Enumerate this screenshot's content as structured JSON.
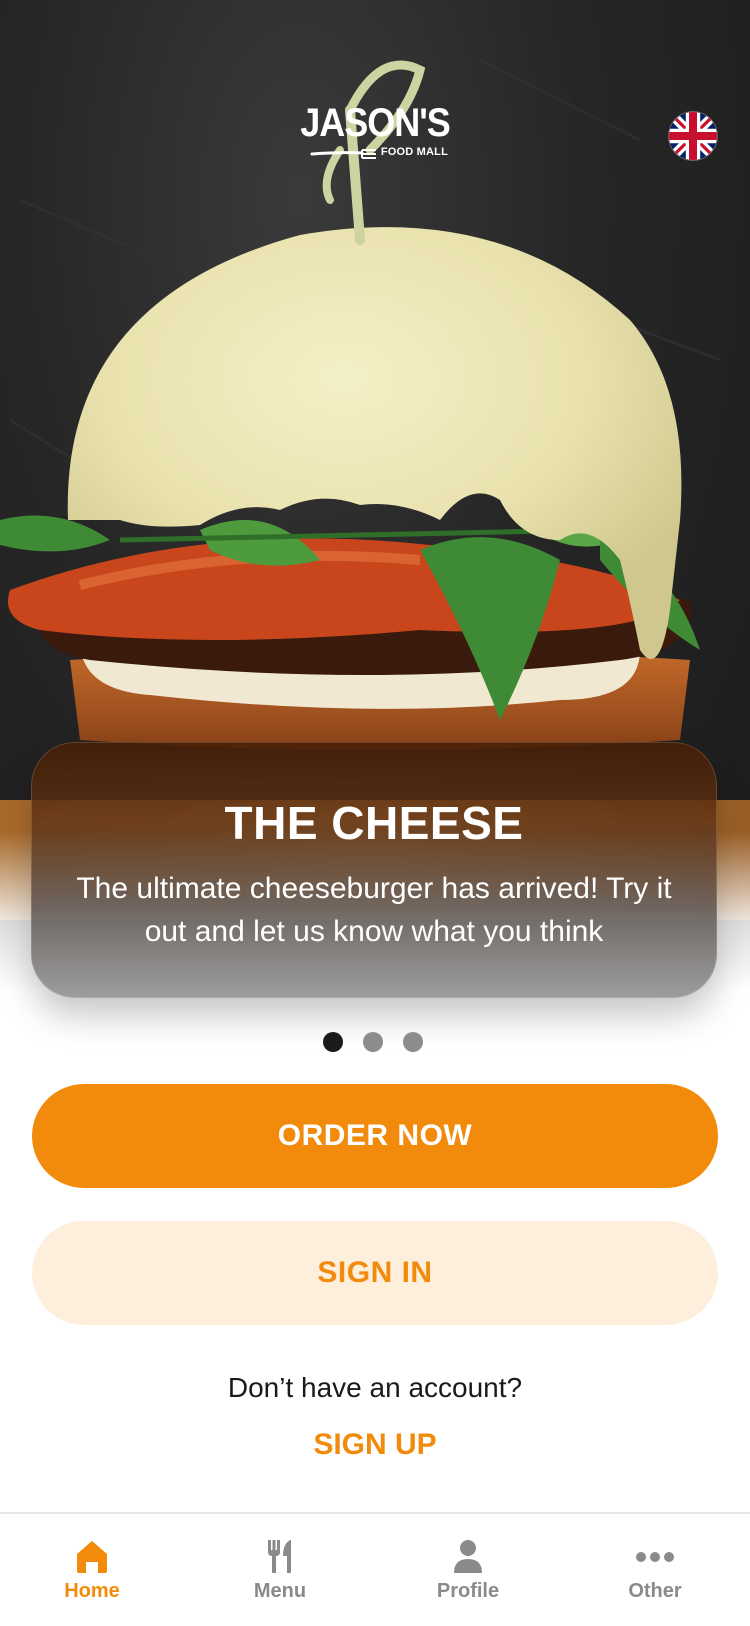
{
  "header": {
    "logo_main": "JASON'S",
    "logo_sub": "FOOD MALL",
    "language_icon": "uk-flag-icon"
  },
  "promo": {
    "title": "THE CHEESE",
    "description": "The ultimate cheeseburger has arrived! Try it out and let us know what you think",
    "slides_total": 3,
    "active_slide": 1
  },
  "actions": {
    "order_now": "ORDER NOW",
    "sign_in": "SIGN IN",
    "no_account": "Don’t have an account?",
    "sign_up": "SIGN UP"
  },
  "tabbar": {
    "items": [
      {
        "label": "Home",
        "icon": "home-icon",
        "active": true
      },
      {
        "label": "Menu",
        "icon": "fork-knife-icon",
        "active": false
      },
      {
        "label": "Profile",
        "icon": "person-icon",
        "active": false
      },
      {
        "label": "Other",
        "icon": "more-dots-icon",
        "active": false
      }
    ]
  },
  "colors": {
    "accent": "#f28b0c",
    "accent_light": "#fdefdc",
    "inactive_tab": "#8a8a8a"
  }
}
